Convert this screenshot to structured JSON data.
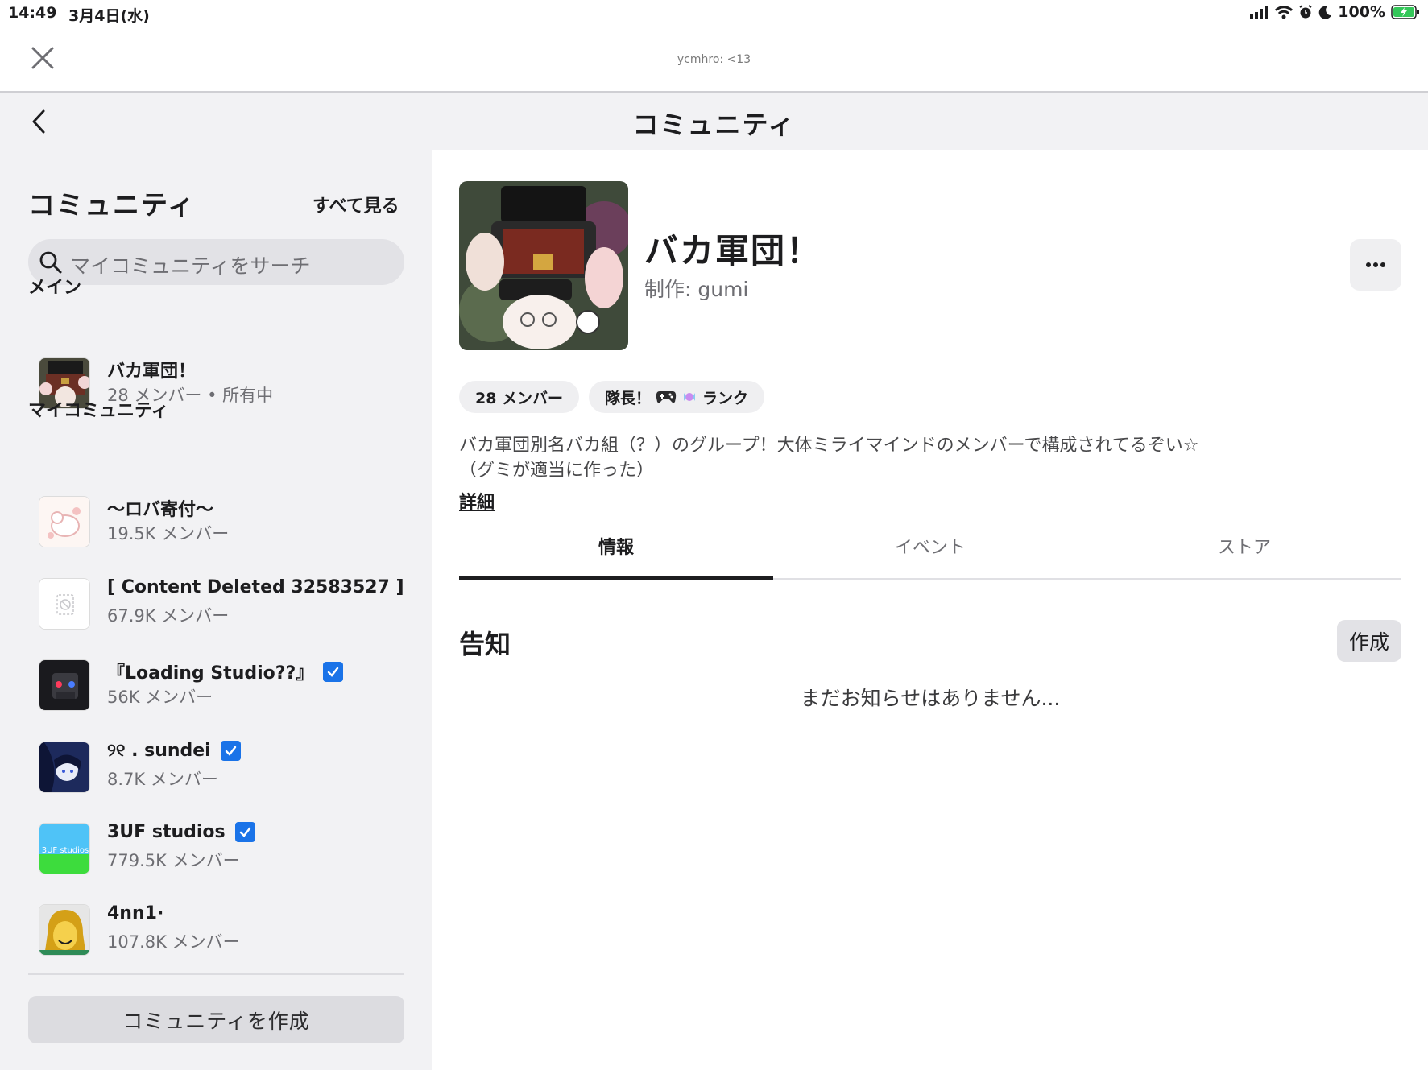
{
  "status_bar": {
    "time": "14:49",
    "date": "3月4日(水)",
    "battery": "100%"
  },
  "browser": {
    "url": "ycmhro: <13"
  },
  "header": {
    "title": "コミュニティ"
  },
  "sidebar": {
    "title": "コミュニティ",
    "see_all": "すべて見る",
    "search_placeholder": "マイコミュニティをサーチ",
    "main_section": "メイン",
    "main_item": {
      "name": "バカ軍団！",
      "members": "28 メンバー",
      "owned": "所有中"
    },
    "my_section": "マイコミュニティ",
    "items": [
      {
        "name": "～ロバ寄付～",
        "members": "19.5K メンバー",
        "verified": false
      },
      {
        "name": "[ Content Deleted 32583527 ]",
        "members": "67.9K メンバー",
        "verified": false
      },
      {
        "name": "『Loading Studio??』",
        "members": "56K メンバー",
        "verified": true
      },
      {
        "name": "୨୧ . sundei",
        "members": "8.7K メンバー",
        "verified": true
      },
      {
        "name": "3UF studios",
        "members": "779.5K メンバー",
        "verified": true
      },
      {
        "name": "4nn1·",
        "members": "107.8K メンバー",
        "verified": false
      }
    ],
    "thumb_text_3uf": "3UF studios",
    "create_button": "コミュニティを作成"
  },
  "group": {
    "name": "バカ軍団！",
    "creator": "制作: gumi",
    "members_chip": "28 メンバー",
    "rank_chip_prefix": "隊長！",
    "rank_chip_suffix": "ランク",
    "description_line1": "バカ軍団別名バカ組（？）のグループ！大体ミライマインドのメンバーで構成されてるぞい☆",
    "description_line2": "（グミが適当に作った）",
    "details_link": "詳細",
    "tabs": [
      {
        "label": "情報",
        "active": true
      },
      {
        "label": "イベント",
        "active": false
      },
      {
        "label": "ストア",
        "active": false
      }
    ],
    "announcements_title": "告知",
    "announcements_create": "作成",
    "announcements_empty": "まだお知らせはありません..."
  },
  "colors": {
    "verified": "#1a73e8",
    "sidebar_bg": "#f2f2f4",
    "battery": "#34c759"
  }
}
